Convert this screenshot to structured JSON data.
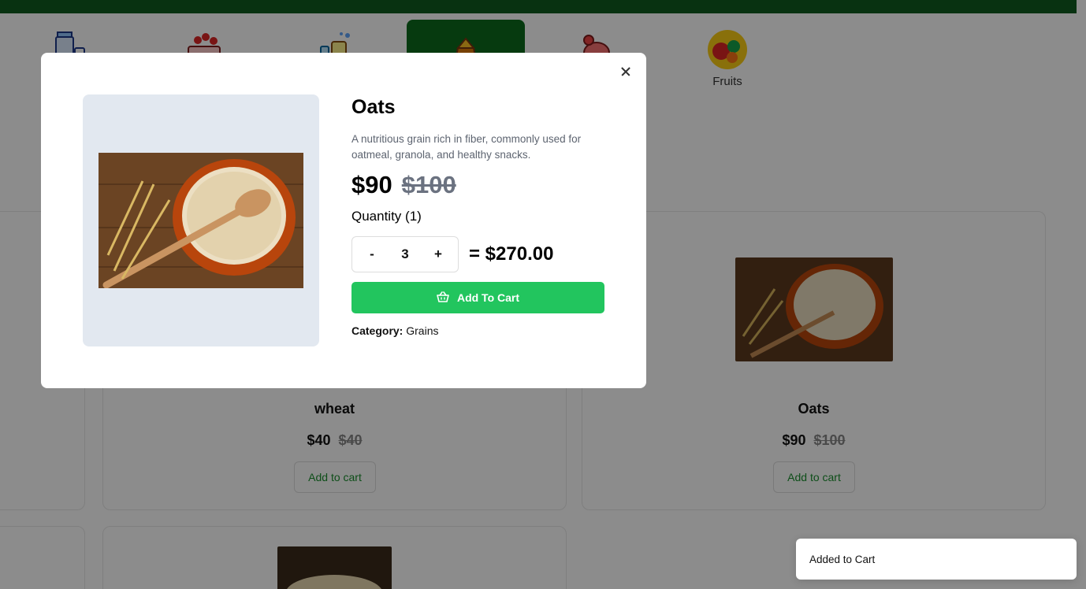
{
  "colors": {
    "brand_green": "#0f5b1f",
    "active_category": "#0c6b1c",
    "add_to_cart": "#22c55e",
    "image_panel": "#e2e8f0"
  },
  "categories": [
    {
      "label": "",
      "icon": "milk-icon"
    },
    {
      "label": "",
      "icon": "cake-icon"
    },
    {
      "label": "",
      "icon": "cleaning-icon"
    },
    {
      "label": "",
      "icon": "grains-icon",
      "active": true
    },
    {
      "label": "",
      "icon": "chicken-icon"
    },
    {
      "label": "Fruits",
      "icon": "fruits-icon"
    }
  ],
  "products": [
    {
      "name": "wheat",
      "price": "$40",
      "old_price": "$40",
      "button": "Add to cart"
    },
    {
      "name": "Oats",
      "price": "$90",
      "old_price": "$100",
      "button": "Add to cart"
    }
  ],
  "modal": {
    "title": "Oats",
    "description": "A nutritious grain rich in fiber, commonly used for oatmeal, granola, and healthy snacks.",
    "price": "$90",
    "old_price": "$100",
    "quantity_label": "Quantity (1)",
    "decrement": "-",
    "quantity": "3",
    "increment": "+",
    "total": "= $270.00",
    "add_button": "Add To Cart",
    "category_label": "Category:",
    "category_value": "Grains"
  },
  "toast": {
    "message": "Added to Cart"
  }
}
